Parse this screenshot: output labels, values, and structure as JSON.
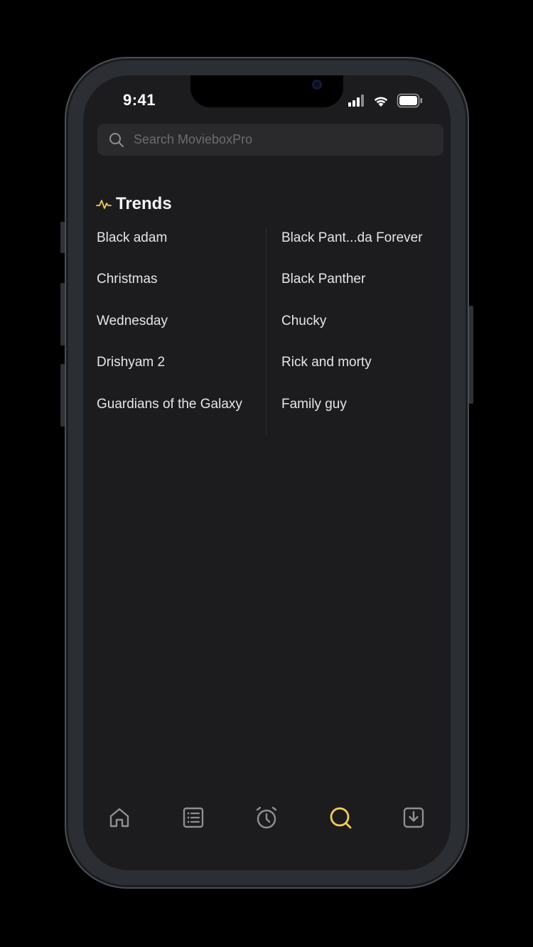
{
  "status_bar": {
    "time": "9:41"
  },
  "search": {
    "placeholder": "Search MovieboxPro",
    "value": ""
  },
  "trends": {
    "title": "Trends",
    "left_column": [
      "Black adam",
      "Christmas",
      "Wednesday",
      "Drishyam 2",
      "Guardians of the Galaxy"
    ],
    "right_column": [
      "Black Pant...da Forever",
      "Black Panther",
      "Chucky",
      "Rick and morty",
      "Family guy"
    ]
  },
  "tab_bar": {
    "tabs": [
      {
        "icon": "home-icon",
        "active": false
      },
      {
        "icon": "list-icon",
        "active": false
      },
      {
        "icon": "alarm-clock-icon",
        "active": false
      },
      {
        "icon": "search-icon",
        "active": true
      },
      {
        "icon": "download-icon",
        "active": false
      }
    ]
  },
  "colors": {
    "background": "#1c1c1e",
    "accent": "#f5cf55",
    "text": "#e5e5ea",
    "inactive_icon": "#8e8e93",
    "search_field": "#2a2a2c"
  }
}
